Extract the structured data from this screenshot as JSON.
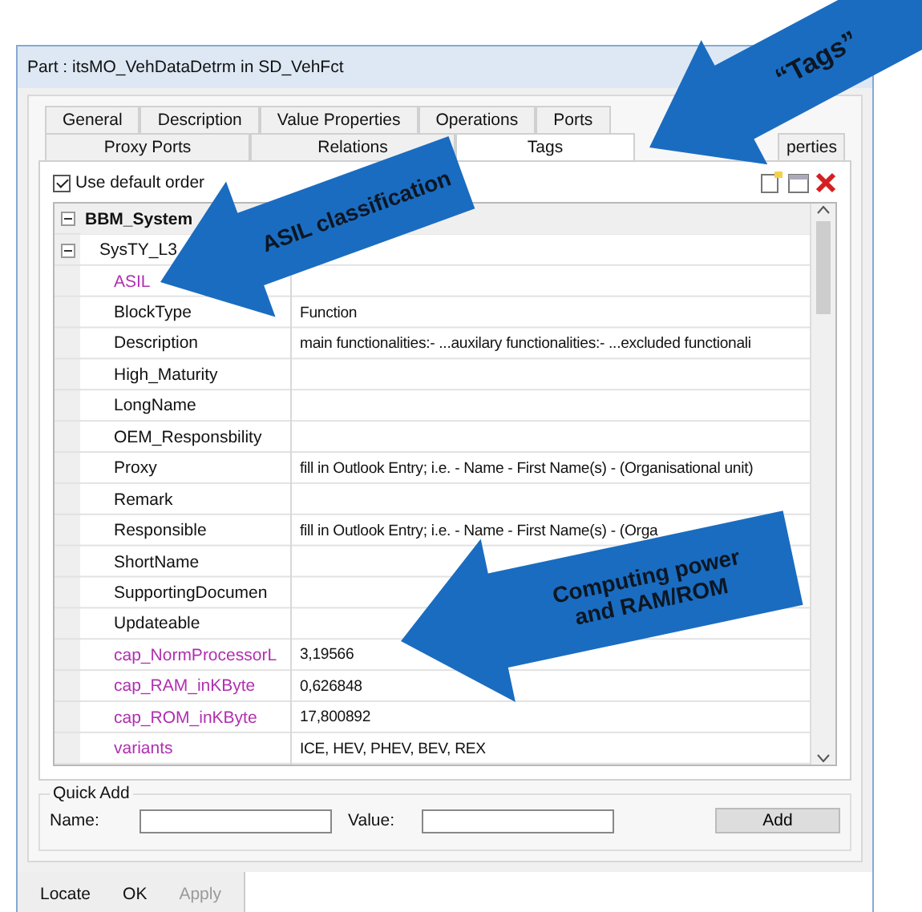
{
  "window": {
    "title": "Part : itsMO_VehDataDetrm in SD_VehFct"
  },
  "tab_rows": [
    [
      {
        "label": "General",
        "selected": false
      },
      {
        "label": "Description",
        "selected": false
      },
      {
        "label": "Value Properties",
        "selected": false
      },
      {
        "label": "Operations",
        "selected": false
      },
      {
        "label": "Ports",
        "selected": false
      }
    ],
    [
      {
        "label": "Proxy Ports",
        "selected": false
      },
      {
        "label": "Relations",
        "selected": false
      },
      {
        "label": "Tags",
        "selected": true
      },
      {
        "label": "perties",
        "selected": false
      }
    ]
  ],
  "use_default_order": {
    "label": "Use default order",
    "checked": true
  },
  "tree": [
    {
      "name": "BBM_System",
      "kind": "group",
      "expanded": true,
      "children": [
        {
          "name": "SysTY_L3",
          "kind": "group",
          "expanded": true,
          "children": [
            {
              "name": "ASIL",
              "kind": "tag",
              "highlighted": true
            },
            {
              "name": "BlockType",
              "kind": "tag",
              "highlighted": false,
              "value": "Function"
            },
            {
              "name": "Description",
              "kind": "tag",
              "highlighted": false,
              "value": "main functionalities:- ...auxilary functionalities:- ...excluded functionali"
            },
            {
              "name": "High_Maturity",
              "kind": "tag",
              "highlighted": false
            },
            {
              "name": "LongName",
              "kind": "tag",
              "highlighted": false
            },
            {
              "name": "OEM_Responsbility",
              "kind": "tag",
              "highlighted": false
            },
            {
              "name": "Proxy",
              "kind": "tag",
              "highlighted": false,
              "value": "fill in Outlook Entry; i.e. - Name - First Name(s) - (Organisational unit)"
            },
            {
              "name": "Remark",
              "kind": "tag",
              "highlighted": false
            },
            {
              "name": "Responsible",
              "kind": "tag",
              "highlighted": false,
              "value": "fill in Outlook Entry; i.e. - Name - First Name(s) - (Orga"
            },
            {
              "name": "ShortName",
              "kind": "tag",
              "highlighted": false
            },
            {
              "name": "SupportingDocumen",
              "kind": "tag",
              "highlighted": false
            },
            {
              "name": "Updateable",
              "kind": "tag",
              "highlighted": false
            },
            {
              "name": "cap_NormProcessorL",
              "kind": "tag",
              "highlighted": true,
              "value": "3,19566"
            },
            {
              "name": "cap_RAM_inKByte",
              "kind": "tag",
              "highlighted": true,
              "value": "0,626848"
            },
            {
              "name": "cap_ROM_inKByte",
              "kind": "tag",
              "highlighted": true,
              "value": "17,800892"
            },
            {
              "name": "variants",
              "kind": "tag",
              "highlighted": true,
              "value": "ICE, HEV, PHEV, BEV, REX"
            }
          ]
        }
      ]
    }
  ],
  "quick_add": {
    "title": "Quick Add",
    "name_label": "Name:",
    "value_label": "Value:",
    "add_button": "Add"
  },
  "buttons": [
    {
      "label": "Locate",
      "disabled": false
    },
    {
      "label": "OK",
      "disabled": false
    },
    {
      "label": "Apply",
      "disabled": true
    }
  ],
  "callouts": [
    {
      "lines": [
        "“Tags”"
      ]
    },
    {
      "lines": [
        "ASIL classification"
      ]
    },
    {
      "lines": [
        "Computing power",
        "and RAM/ROM"
      ]
    }
  ]
}
